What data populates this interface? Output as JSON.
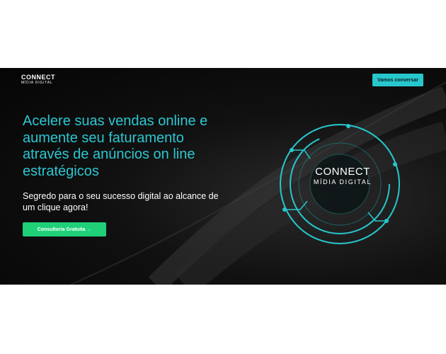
{
  "header": {
    "logo_line1": "CONNECT",
    "logo_line2": "MÍDIA DIGITAL",
    "cta_label": "Vamos conversar"
  },
  "hero": {
    "headline": "Acelere suas vendas online e aumente seu faturamento através de anúncios on line estratégicos",
    "subtitle": "Segredo para o seu sucesso digital ao alcance de um clique agora!",
    "cta_label": "Consultoria Gratuita →"
  },
  "emblem": {
    "title": "CONNECT",
    "subtitle": "MÍDIA DIGITAL"
  },
  "colors": {
    "accent": "#27c7cd",
    "cta_green": "#1fd079",
    "background": "#0b0b0b"
  }
}
